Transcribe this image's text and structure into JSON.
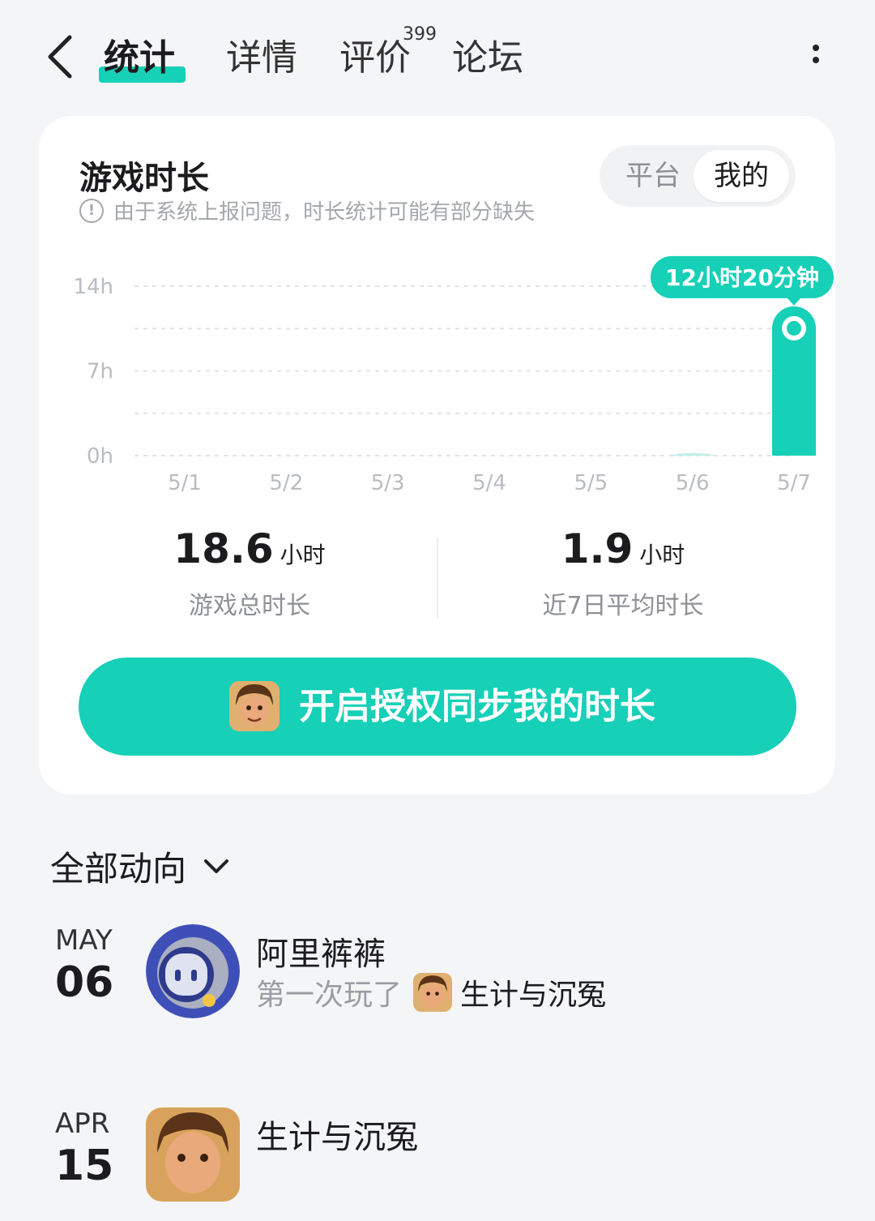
{
  "header": {
    "tabs": [
      {
        "label": "统计",
        "active": true
      },
      {
        "label": "详情"
      },
      {
        "label": "评价",
        "badge": "399"
      },
      {
        "label": "论坛"
      }
    ]
  },
  "card": {
    "title": "游戏时长",
    "note": "由于系统上报问题，时长统计可能有部分缺失",
    "toggle": {
      "options": [
        "平台",
        "我的"
      ],
      "selected": "我的"
    },
    "stats": [
      {
        "value": "18.6",
        "unit": "小时",
        "label": "游戏总时长"
      },
      {
        "value": "1.9",
        "unit": "小时",
        "label": "近7日平均时长"
      }
    ],
    "cta_label": "开启授权同步我的时长"
  },
  "chart_data": {
    "type": "bar",
    "categories": [
      "5/1",
      "5/2",
      "5/3",
      "5/4",
      "5/5",
      "5/6",
      "5/7"
    ],
    "values": [
      0,
      0,
      0,
      0,
      0,
      0.2,
      12.33
    ],
    "yticks": [
      "0h",
      "7h",
      "14h"
    ],
    "ylim": [
      0,
      14
    ],
    "tooltip": "12小时20分钟",
    "highlight_index": 6,
    "grid": true,
    "colors": {
      "bar": "#16d0b7",
      "bar_faint": "#bfeee7",
      "grid": "#e1e3e6"
    }
  },
  "feed": {
    "filter_label": "全部动向",
    "items": [
      {
        "month": "MAY",
        "day": "06",
        "name": "阿里裤裤",
        "action": "第一次玩了",
        "game": "生计与沉冤"
      },
      {
        "month": "APR",
        "day": "15",
        "name": "生计与沉冤",
        "action": ""
      }
    ]
  },
  "colors": {
    "accent": "#16d0b7",
    "background": "#f4f5f7"
  }
}
